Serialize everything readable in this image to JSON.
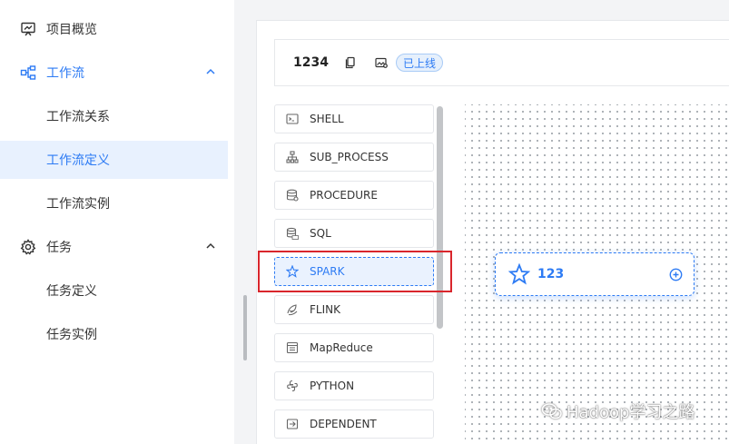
{
  "sidebar": {
    "project_overview": "项目概览",
    "workflow": "工作流",
    "workflow_relation": "工作流关系",
    "workflow_definition": "工作流定义",
    "workflow_instance": "工作流实例",
    "task": "任务",
    "task_definition": "任务定义",
    "task_instance": "任务实例"
  },
  "header": {
    "workflow_name": "1234",
    "status": "已上线"
  },
  "palette": {
    "items": [
      {
        "label": "SHELL",
        "icon": "terminal-icon"
      },
      {
        "label": "SUB_PROCESS",
        "icon": "sub-process-icon"
      },
      {
        "label": "PROCEDURE",
        "icon": "database-icon"
      },
      {
        "label": "SQL",
        "icon": "sql-icon"
      },
      {
        "label": "SPARK",
        "icon": "spark-star-icon"
      },
      {
        "label": "FLINK",
        "icon": "flink-icon"
      },
      {
        "label": "MapReduce",
        "icon": "mapreduce-icon"
      },
      {
        "label": "PYTHON",
        "icon": "python-icon"
      },
      {
        "label": "DEPENDENT",
        "icon": "dependent-icon"
      }
    ]
  },
  "canvas": {
    "node_label": "123"
  },
  "watermark": {
    "text": "Hadoop学习之路"
  },
  "colors": {
    "accent": "#2d7bf4",
    "highlight": "#d9262c",
    "selected_bg": "#e8f1fe"
  }
}
